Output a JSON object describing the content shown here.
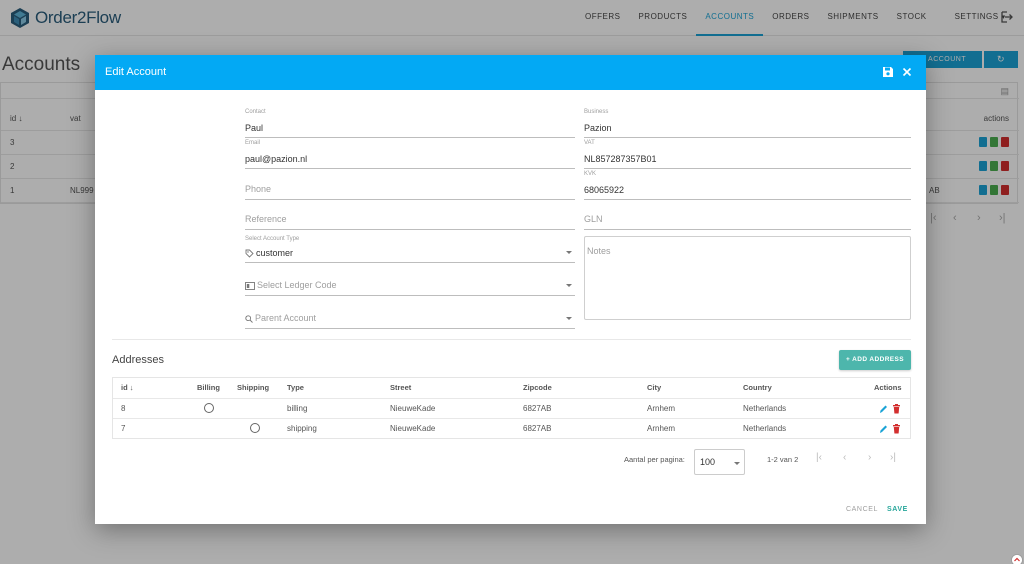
{
  "app": {
    "brand": "Order2Flow",
    "nav": [
      {
        "label": "OFFERS",
        "active": false
      },
      {
        "label": "PRODUCTS",
        "active": false
      },
      {
        "label": "ACCOUNTS",
        "active": true
      },
      {
        "label": "ORDERS",
        "active": false
      },
      {
        "label": "SHIPMENTS",
        "active": false
      },
      {
        "label": "STOCK",
        "active": false
      },
      {
        "label": "SETTINGS",
        "active": false
      }
    ],
    "accent_color": "#1ba3d6"
  },
  "background": {
    "page_title": "Accounts",
    "new_account_label": "W ACCOUNT",
    "refresh_icon": "refresh-icon",
    "columns": {
      "id": "id",
      "vat": "vat",
      "actions": "actions"
    },
    "rows": [
      {
        "id": "3",
        "vat": "",
        "tail": ""
      },
      {
        "id": "2",
        "vat": "",
        "tail": ""
      },
      {
        "id": "1",
        "vat": "NL999",
        "tail": "AB"
      }
    ]
  },
  "dialog": {
    "title": "Edit Account",
    "header_color": "#03a9f4",
    "contact": {
      "label": "Contact",
      "value": "Paul"
    },
    "email": {
      "label": "Email",
      "value": "paul@pazion.nl"
    },
    "phone": {
      "placeholder": "Phone"
    },
    "reference": {
      "placeholder": "Reference"
    },
    "account_type": {
      "label": "Select Account Type",
      "value": "customer"
    },
    "ledger_code": {
      "placeholder": "Select Ledger Code"
    },
    "parent_account": {
      "placeholder": "Parent Account"
    },
    "business": {
      "label": "Business",
      "value": "Pazion"
    },
    "vat": {
      "label": "VAT",
      "value": "NL857287357B01"
    },
    "kvk": {
      "label": "KVK",
      "value": "68065922"
    },
    "gln": {
      "placeholder": "GLN"
    },
    "notes": {
      "placeholder": "Notes"
    },
    "addresses": {
      "title": "Addresses",
      "add_button": "+ ADD ADDRESS",
      "columns": {
        "id": "id",
        "billing": "Billing",
        "shipping": "Shipping",
        "type": "Type",
        "street": "Street",
        "zipcode": "Zipcode",
        "city": "City",
        "country": "Country",
        "actions": "Actions"
      },
      "rows": [
        {
          "id": "8",
          "billing_radio": true,
          "shipping_radio": false,
          "type": "billing",
          "street": "NieuweKade",
          "zipcode": "6827AB",
          "city": "Arnhem",
          "country": "Netherlands"
        },
        {
          "id": "7",
          "billing_radio": false,
          "shipping_radio": true,
          "type": "shipping",
          "street": "NieuweKade",
          "zipcode": "6827AB",
          "city": "Arnhem",
          "country": "Netherlands"
        }
      ],
      "pager": {
        "per_page_label": "Aantal per pagina:",
        "per_page_value": "100",
        "range": "1-2 van 2"
      }
    },
    "cancel_label": "CANCEL",
    "save_label": "SAVE"
  }
}
